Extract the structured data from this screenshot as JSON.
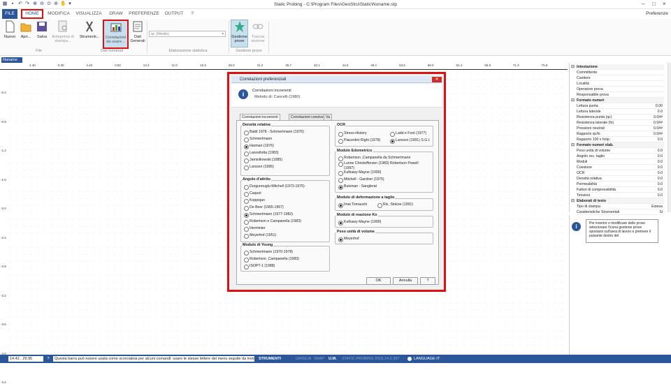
{
  "window": {
    "title": "Static Probing - C:\\Program Files\\GeoStru\\Static\\Noname.stp",
    "preferences_link": "Preferenze"
  },
  "menu": [
    "FILE",
    "HOME",
    "MODIFICA",
    "VISUALIZZA",
    "DRAW",
    "PREFERENZE",
    "OUTPUT",
    "?"
  ],
  "ribbon": {
    "buttons": [
      "Nuovo",
      "Apri...",
      "Salva",
      "Anteprima di stampa...",
      "Strumenti...",
      "Correlazioni da usare...",
      "Dati Generali",
      "Gestione prove",
      "Traccia sezione"
    ],
    "select_value": "qc (Medio)",
    "groups": [
      "File",
      "Dati Generali",
      "Elaborazione statistica",
      "Gestione prove"
    ]
  },
  "doc_tab": "Noname",
  "ruler_top": [
    "4.40",
    "0.30",
    "4.40",
    "0.82",
    "13.4",
    "11.0",
    "22.5",
    "26.0",
    "31.2",
    "35.7",
    "40.1",
    "44.6",
    "49.1",
    "53.5",
    "58.0",
    "62.4",
    "66.9",
    "71.3",
    "75.8"
  ],
  "ruler_left": [
    "-0.4",
    "-0.8",
    "-1.2",
    "-1.6",
    "-2.0",
    "-2.4",
    "-2.8",
    "-3.2",
    "-3.6",
    "-4.0",
    "-4.4"
  ],
  "properties": [
    {
      "k": "Intestazione",
      "v": "",
      "h": true
    },
    {
      "k": "Committente",
      "v": ""
    },
    {
      "k": "Cantiere",
      "v": ""
    },
    {
      "k": "Località",
      "v": ""
    },
    {
      "k": "Operatore prova",
      "v": ""
    },
    {
      "k": "Responsabile prova",
      "v": ""
    },
    {
      "k": "Formato numeri",
      "v": "",
      "h": true
    },
    {
      "k": "Lettura punta",
      "v": "0.00"
    },
    {
      "k": "Lettura laterale",
      "v": "0.0"
    },
    {
      "k": "Resistenza punta (qc)",
      "v": "0.0##"
    },
    {
      "k": "Resistenza laterale (fs)",
      "v": "0.0##"
    },
    {
      "k": "Pressioni neutrali",
      "v": "0.0##"
    },
    {
      "k": "Rapporto qc/fs",
      "v": "0.0##"
    },
    {
      "k": "Rapporto 100 x fs/qc",
      "v": "0.0"
    },
    {
      "k": "Formato numeri elab.",
      "v": "",
      "h": true
    },
    {
      "k": "Peso unità di volume",
      "v": "0.0"
    },
    {
      "k": "Angolo res. taglio",
      "v": "0.0"
    },
    {
      "k": "Moduli",
      "v": "0.0"
    },
    {
      "k": "Coesione",
      "v": "0.0"
    },
    {
      "k": "OCR",
      "v": "0.0"
    },
    {
      "k": "Densità relativa",
      "v": "0.0"
    },
    {
      "k": "Permeabilità",
      "v": "0.0"
    },
    {
      "k": "Fattori di compressibilità",
      "v": "0.0"
    },
    {
      "k": "Tensioni",
      "v": "0.0"
    },
    {
      "k": "Elaborati di testo",
      "v": "",
      "h": true
    },
    {
      "k": "Tipo di stampa",
      "v": "Estesa"
    },
    {
      "k": "Caratteristiche Strumentali",
      "v": "Si"
    }
  ],
  "info_panel": "Per inserire o modificare delle prove selezionare l'icona gestione prove spostarsi sull'area di lavoro e premere il pulsante destro del",
  "dialog": {
    "title": "Correlazioni preferenziali",
    "header_line1": "Correlazioni incoerenti",
    "header_line2": "Metodo di: Cancelli (1980)",
    "tabs": [
      "Correlazioni incoerenti",
      "Correlazioni coesive",
      "Va"
    ],
    "groups": {
      "densita": {
        "title": "Densità relativa",
        "options": [
          "Baldi 1978 - Schmertmann (1976)",
          "Schmertmann",
          "Harman (1976)",
          "Lancellotta (1983)",
          "Jamiolkowski (1985)",
          "Larsson (1995)"
        ],
        "selected": 2
      },
      "attrito": {
        "title": "Angolo d'attrito",
        "options": [
          "Durgunouglu-Mitchell (1973-1975)",
          "Caquot",
          "Koppejan",
          "De Beer (1965-1967)",
          "Schmertmann (1977-1982)",
          "Robertson e Campanella (1983)",
          "Herminier",
          "Meyerhof (1951)"
        ],
        "selected": 4
      },
      "young": {
        "title": "Modulo di Young",
        "options": [
          "Schmertmann (1970-1978)",
          "Robertson ,Campanella (1983)",
          "ISOPT-1 (1988)"
        ],
        "selected": -1
      },
      "ocr": {
        "title": "OCR",
        "options": [
          "Stress-History",
          "Piacentini Righi (1978)",
          "Ladd e Foot (1977)",
          "Larsson (1991) S.G.I."
        ],
        "selected": 3
      },
      "edometrico": {
        "title": "Modulo Edometrico",
        "options": [
          "Robertson ,Campanella da Schmertmann",
          "Lunne Christoffersen (1983) Robertson Powell (1997)",
          "Kulhawy-Mayne (1990)",
          "Mitchell - Gardner (1975)",
          "Buisman - Sanglerat"
        ],
        "selected": 4
      },
      "taglio": {
        "title": "Modulo di deformazione a taglio",
        "options": [
          "Imai Tomauchi",
          "Rix, Stokoe (1991)"
        ],
        "selected": 0
      },
      "reazione": {
        "title": "Modulo di reazione Ko",
        "options": [
          "Kulhawy-Mayne (1990)"
        ],
        "selected": 0
      },
      "peso": {
        "title": "Peso unità di volume",
        "options": [
          "Meyerhof"
        ],
        "selected": 0
      }
    },
    "buttons": {
      "ok": "OK",
      "cancel": "Annulla",
      "help": "?"
    }
  },
  "status": {
    "coords": "14.42 , 29.95",
    "hint": "Questa barra può essere usata come scorciatoia per alcuni comandi: usare le stesse lettere dei menu seguite da invio.",
    "strumenti": "STRUMENTI",
    "griglia": "GRIGLIA",
    "snap": "SNAP",
    "um": "U.M.",
    "version": "STATIC PROBING 2015.14.2.397",
    "language": "LANGUAGE-IT"
  },
  "colors": {
    "accent": "#2b579a",
    "highlight": "#dd1111"
  }
}
